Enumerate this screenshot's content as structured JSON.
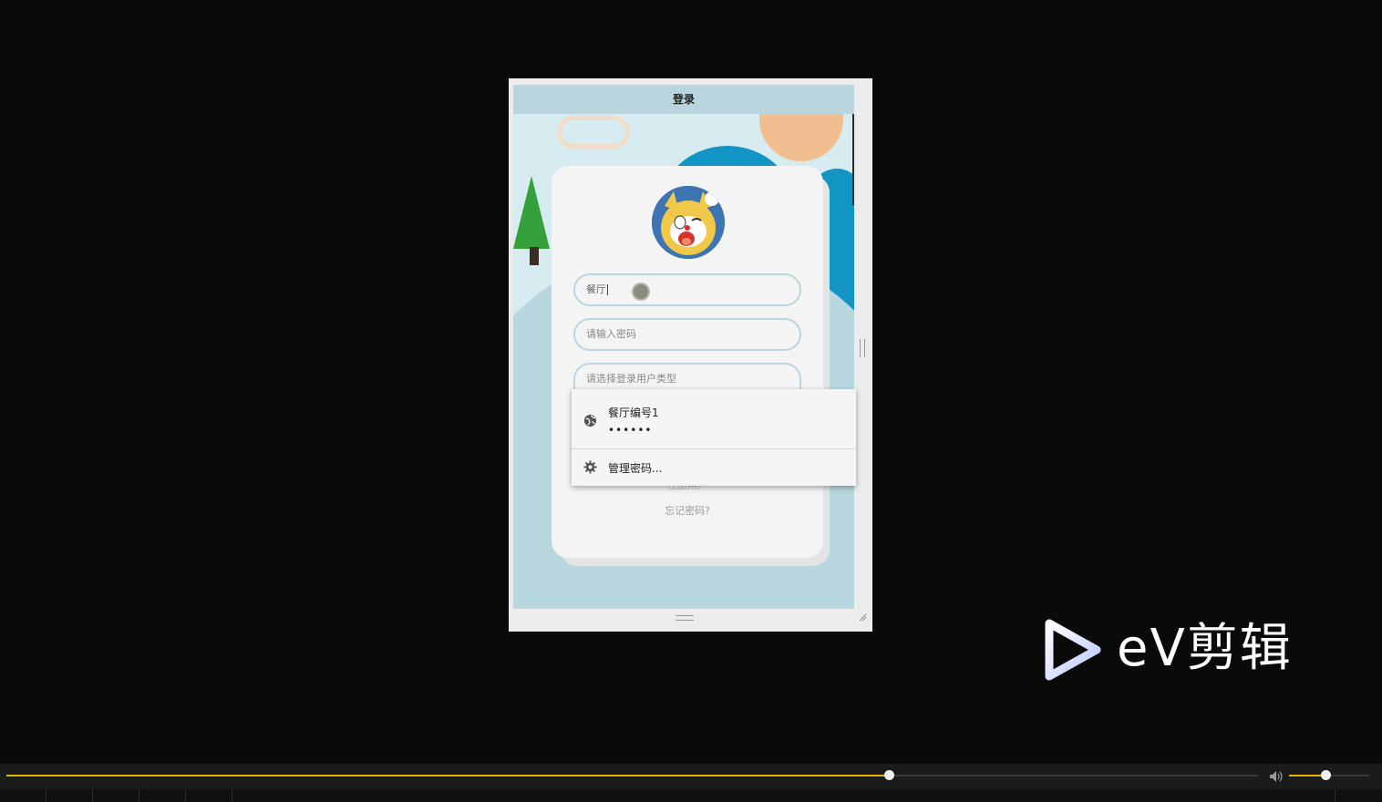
{
  "app": {
    "title": "登录"
  },
  "login": {
    "username_value": "餐厅",
    "password_placeholder": "请输入密码",
    "user_type_placeholder": "请选择登录用户类型",
    "register_link": "注册用户",
    "forgot_link": "忘记密码?"
  },
  "autofill": {
    "username": "餐厅编号1",
    "password_mask": "••••••",
    "manage_label": "管理密码...",
    "icons": [
      "globe-icon",
      "gear-icon"
    ]
  },
  "watermark": {
    "text": "eV剪辑"
  },
  "player": {
    "progress_fraction": 0.705,
    "volume_fraction": 0.45,
    "accent_color": "#e0b800"
  }
}
